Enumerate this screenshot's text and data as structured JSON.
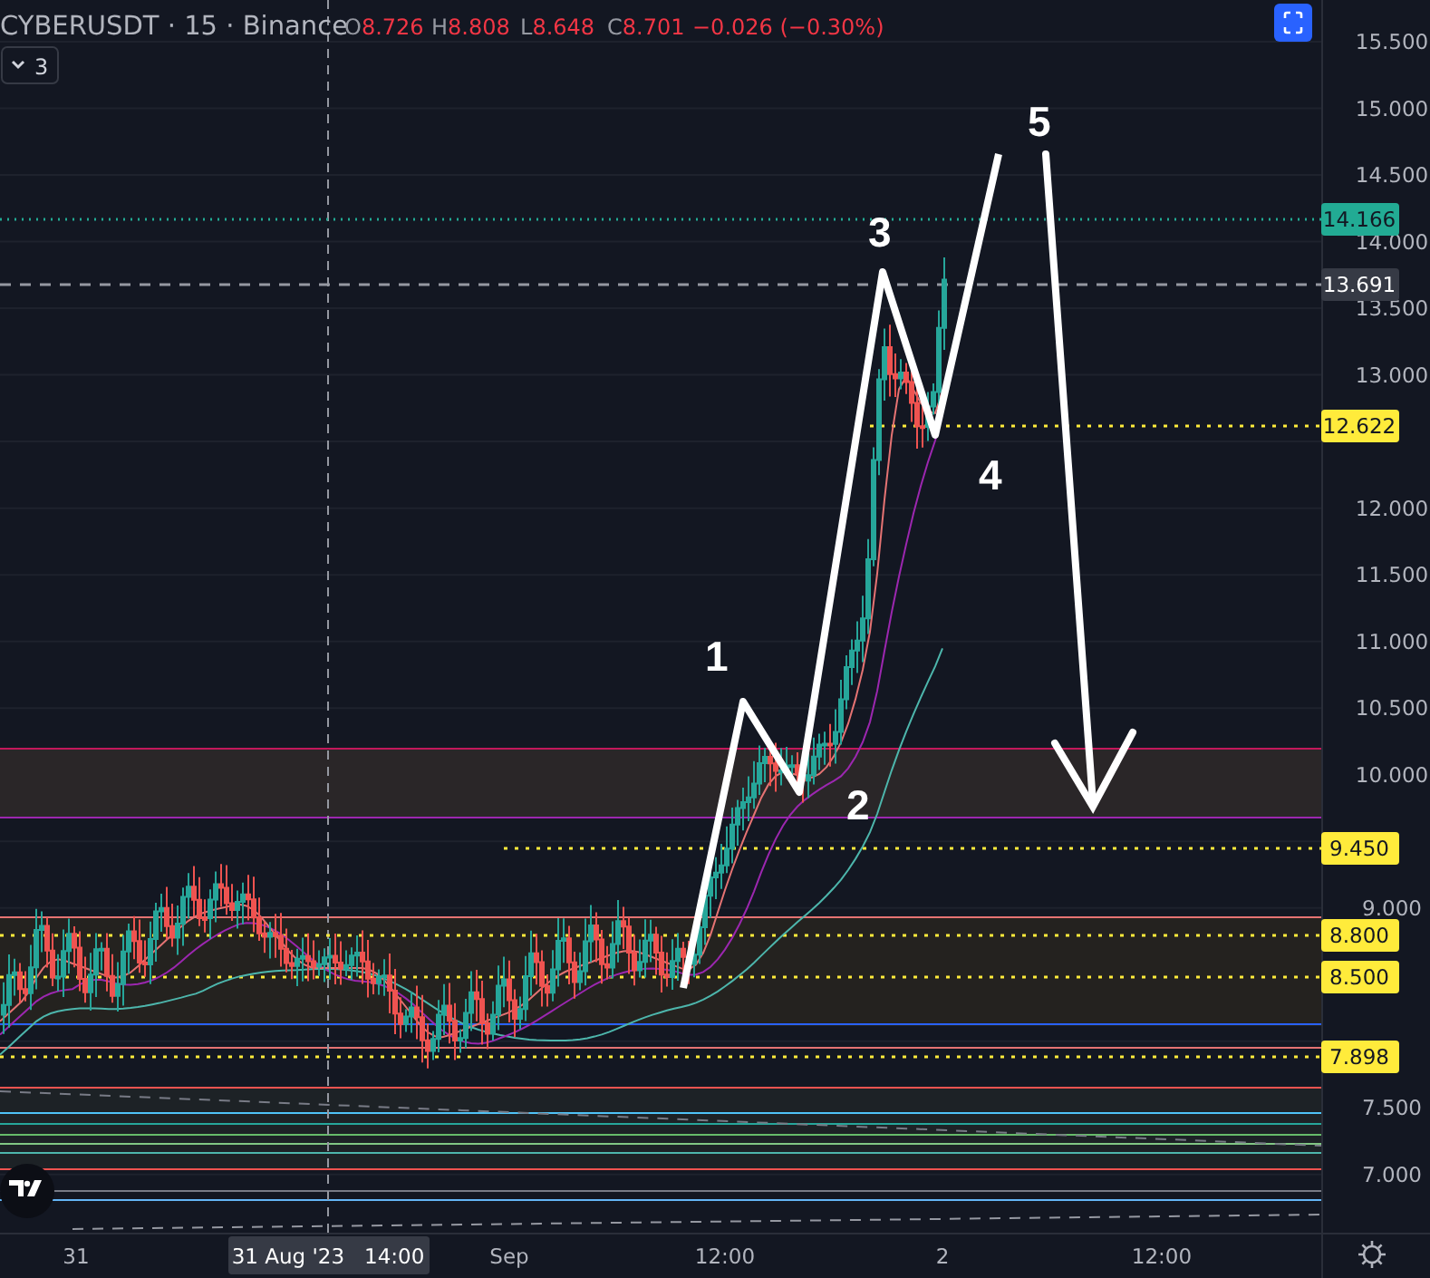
{
  "header": {
    "symbol": "CYBERUSDT · 15 · Binance",
    "ohlc": [
      {
        "label": "O",
        "value": "8.726"
      },
      {
        "label": "H",
        "value": "8.808"
      },
      {
        "label": "L",
        "value": "8.648"
      },
      {
        "label": "C",
        "value": "8.701"
      }
    ],
    "change": "−0.026 (−0.30%)",
    "indicators_count": "3"
  },
  "price_axis": {
    "ticks": [
      "15.500",
      "15.000",
      "14.500",
      "14.000",
      "13.500",
      "13.000",
      "12.000",
      "11.500",
      "11.000",
      "10.500",
      "10.000",
      "9.000",
      "7.500",
      "7.000"
    ]
  },
  "price_tags": [
    {
      "text": "14.166",
      "kind": "last",
      "color": "#22ab94"
    },
    {
      "text": "13.691",
      "kind": "crosshair",
      "color": "#363a45"
    },
    {
      "text": "12.622",
      "kind": "level",
      "color": "#ffeb3b"
    },
    {
      "text": "9.450",
      "kind": "level",
      "color": "#ffeb3b"
    },
    {
      "text": "8.800",
      "kind": "level",
      "color": "#ffeb3b"
    },
    {
      "text": "8.500",
      "kind": "level",
      "color": "#ffeb3b"
    },
    {
      "text": "7.898",
      "kind": "level",
      "color": "#ffeb3b"
    }
  ],
  "wave_labels": [
    "1",
    "2",
    "3",
    "4",
    "5"
  ],
  "time_axis": {
    "ticks": [
      "31",
      "Sep",
      "12:00",
      "2",
      "12:00"
    ],
    "crosshair_date": "31 Aug '23",
    "crosshair_time": "14:00"
  }
}
